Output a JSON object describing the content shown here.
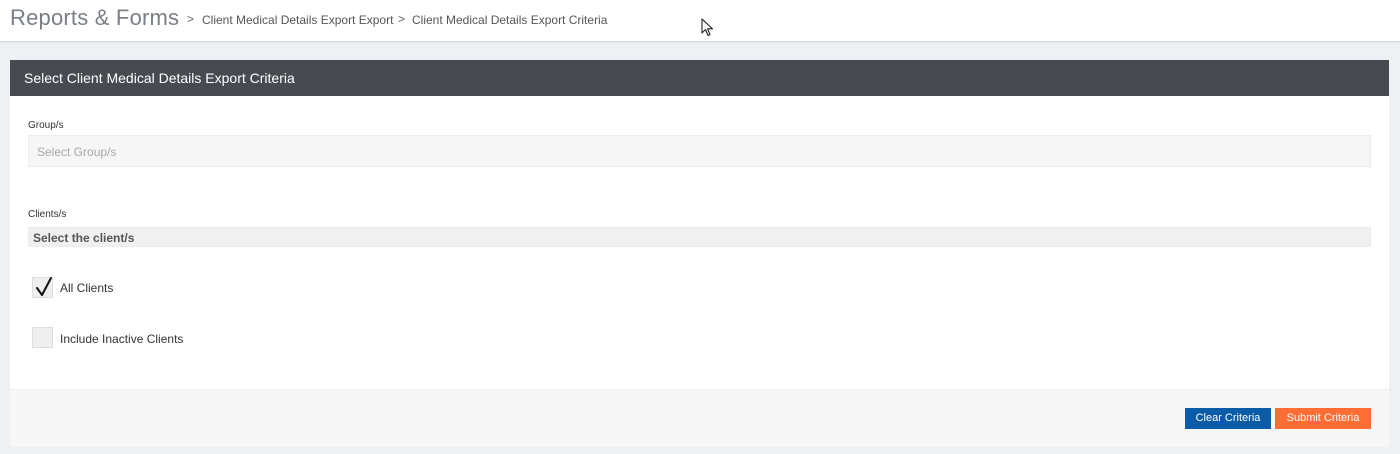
{
  "header": {
    "app_title": "Reports & Forms",
    "breadcrumbs": [
      {
        "label": "Client Medical Details Export Export"
      },
      {
        "label": "Client Medical Details Export Criteria"
      }
    ],
    "separator": ">"
  },
  "card": {
    "title": "Select Client Medical Details Export Criteria",
    "groups": {
      "label": "Group/s",
      "placeholder": "Select Group/s",
      "value": ""
    },
    "clients": {
      "label": "Clients/s",
      "placeholder": "Select the client/s",
      "value": ""
    },
    "options": [
      {
        "label": "All Clients",
        "checked": true
      },
      {
        "label": "Include Inactive Clients",
        "checked": false
      }
    ]
  },
  "footer": {
    "clear_label": "Clear Criteria",
    "submit_label": "Submit Criteria"
  },
  "colors": {
    "header_bar": "#474b51",
    "clear_button": "#0a5ca8",
    "submit_button": "#ff6d35"
  },
  "icons": {
    "breadcrumb_separator": "chevron-right-icon",
    "check": "checkmark-icon",
    "cursor": "mouse-pointer-icon"
  }
}
